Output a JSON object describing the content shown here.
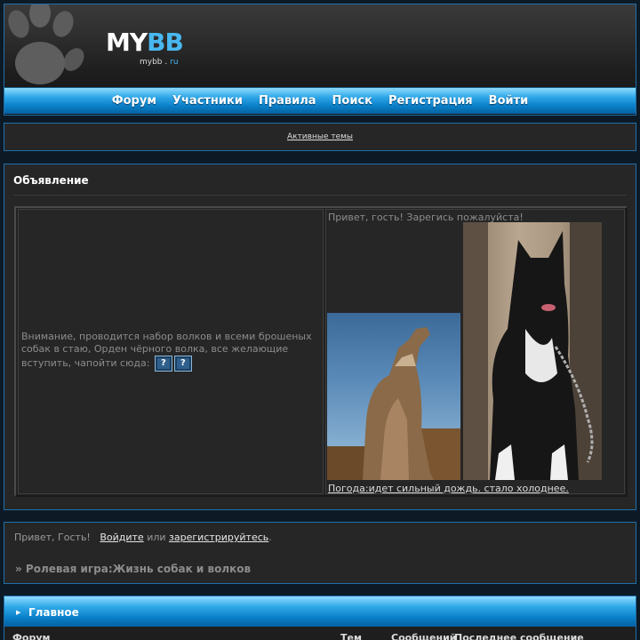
{
  "header": {
    "logo_my": "MY",
    "logo_bb": "BB",
    "logo_sub_main": "mybb",
    "logo_sub_dot": " . ",
    "logo_sub_ru": "ru"
  },
  "nav": [
    {
      "label": "Форум"
    },
    {
      "label": "Участники"
    },
    {
      "label": "Правила"
    },
    {
      "label": "Поиск"
    },
    {
      "label": "Регистрация"
    },
    {
      "label": "Войти"
    }
  ],
  "active_topics": "Активные темы",
  "announcement": {
    "title": "Объявление",
    "left_text": "Внимание, проводится набор волков и всеми брошеных собак в стаю, Орден чёрного волка, все желающие вступить, чапойти сюда:",
    "icon1": "?",
    "icon2": "?",
    "greeting": "Привет, гость! Зарегись пожалуйста!",
    "weather": "Погода:идет сильный дождь. стало холоднее."
  },
  "welcome": {
    "prefix": "Привет, Гость!",
    "login": "Войдите",
    "or": "или",
    "register": "зарегистрируйтесь",
    "dot": "."
  },
  "breadcrumb": "» Ролевая игра:Жизнь собак и волков",
  "category": {
    "title": "Главное",
    "arrow": "▶",
    "columns": [
      "Форум",
      "Тем",
      "Сообщений",
      "Последнее сообщение"
    ]
  },
  "colors": {
    "accent": "#1e6fa8",
    "nav_gradient_top": "#8fdcff",
    "nav_gradient_bottom": "#0561a0",
    "panel_bg": "#262626",
    "page_bg": "#0d1a26"
  }
}
